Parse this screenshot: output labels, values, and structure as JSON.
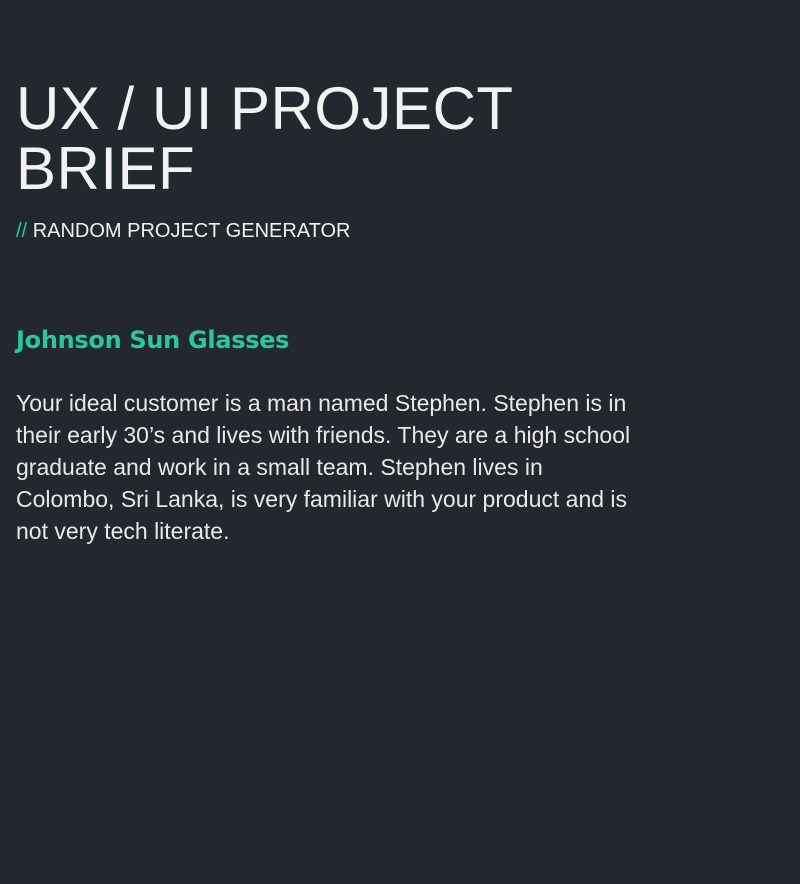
{
  "header": {
    "title": "UX / UI PROJECT BRIEF",
    "subtitle_prefix": "//",
    "subtitle": "RANDOM PROJECT GENERATOR"
  },
  "project": {
    "name": "Johnson Sun Glasses",
    "description": "Your ideal customer is a man named Stephen. Stephen is in their early 30’s and lives with friends. They are a high school graduate and work in a small team. Stephen lives in Colombo, Sri Lanka, is very familiar with your product and is not very tech literate."
  },
  "colors": {
    "background": "#23282e",
    "accent": "#27c8a0",
    "text": "#f2f2f2"
  }
}
